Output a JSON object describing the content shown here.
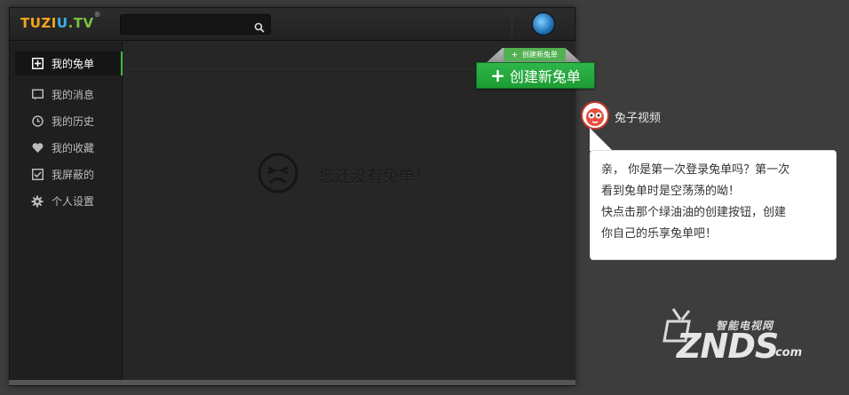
{
  "header": {
    "logo": {
      "part1": "TUZI",
      "part2": "U",
      "part3": ".TV",
      "reg": "®"
    },
    "search": {
      "placeholder": "",
      "value": ""
    }
  },
  "sidebar": {
    "items": [
      {
        "label": "我的兔单",
        "icon": "plus-square-icon",
        "active": true
      },
      {
        "label": "我的消息",
        "icon": "message-icon",
        "active": false
      },
      {
        "label": "我的历史",
        "icon": "clock-icon",
        "active": false
      },
      {
        "label": "我的收藏",
        "icon": "heart-icon",
        "active": false
      },
      {
        "label": "我屏蔽的",
        "icon": "checkbox-icon",
        "active": false
      },
      {
        "label": "个人设置",
        "icon": "gear-icon",
        "active": false
      }
    ]
  },
  "main": {
    "empty_text": "您还没有兔单！"
  },
  "create": {
    "small_label": "创建新兔单",
    "big_label": "创建新兔单"
  },
  "guide": {
    "name": "兔子视频",
    "lines": [
      "亲， 你是第一次登录兔单吗？第一次",
      "看到兔单时是空荡荡的呦！",
      "快点击那个绿油油的创建按钮，创建",
      "你自己的乐享兔单吧！"
    ]
  },
  "watermark": {
    "top": "智能电视网",
    "main": "ZNDS",
    "suffix": ".com"
  },
  "colors": {
    "accent_green": "#2fb64a",
    "logo_orange": "#f5a51b",
    "logo_blue": "#37b3e8",
    "logo_green": "#7ac143"
  }
}
